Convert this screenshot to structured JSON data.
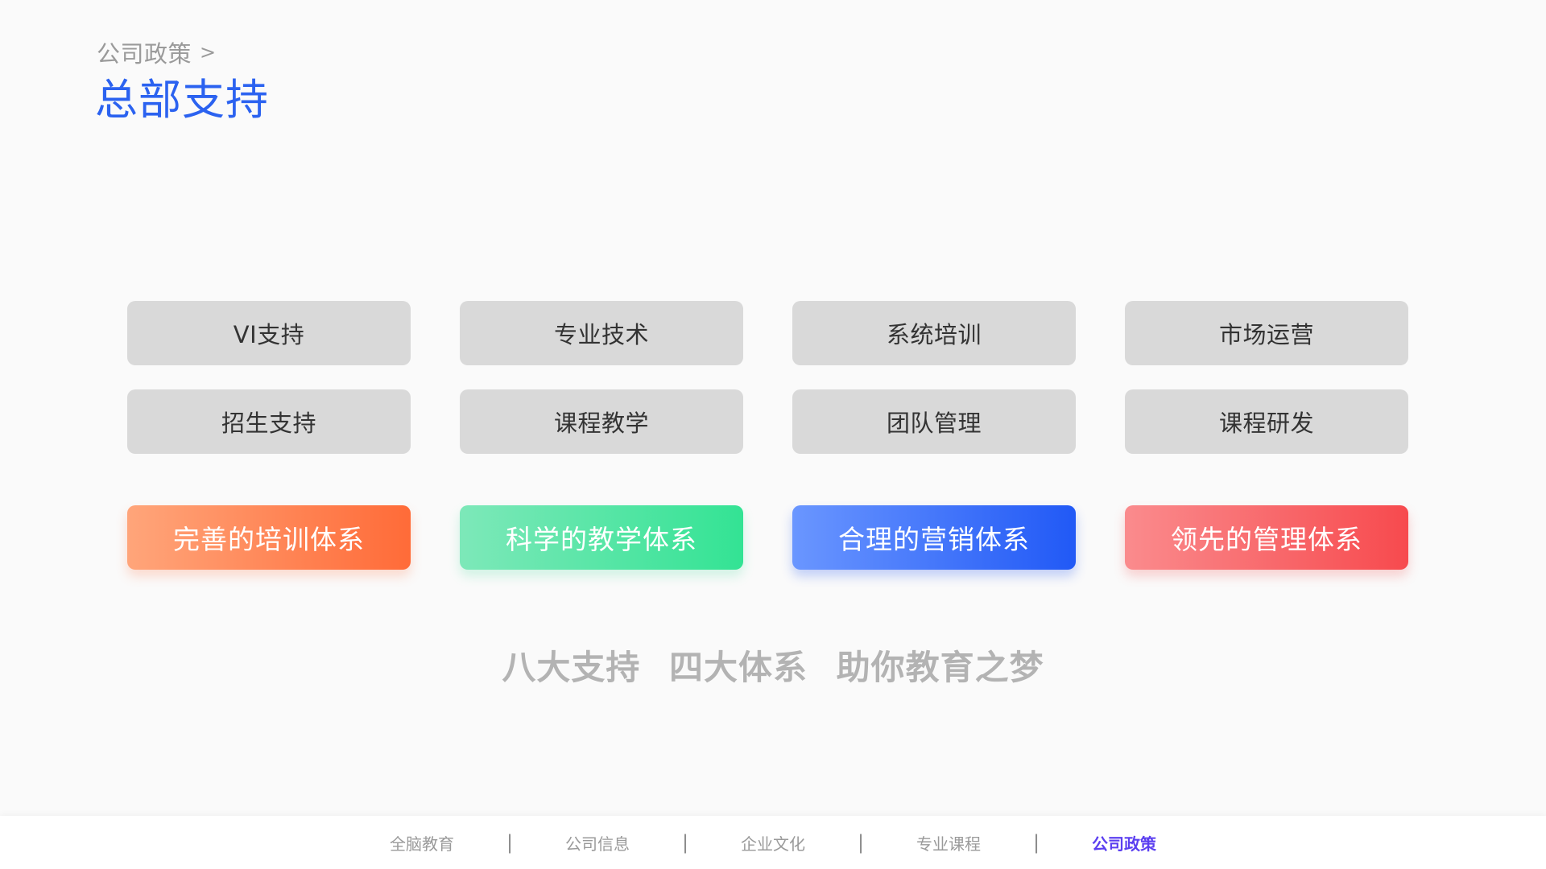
{
  "breadcrumb": {
    "parent": "公司政策",
    "separator": ">"
  },
  "page": {
    "title": "总部支持"
  },
  "supports": [
    {
      "label": "VI支持"
    },
    {
      "label": "专业技术"
    },
    {
      "label": "系统培训"
    },
    {
      "label": "市场运营"
    },
    {
      "label": "招生支持"
    },
    {
      "label": "课程教学"
    },
    {
      "label": "团队管理"
    },
    {
      "label": "课程研发"
    }
  ],
  "systems": [
    {
      "label": "完善的培训体系",
      "color_start": "#ffa57a",
      "color_end": "#ff6b38"
    },
    {
      "label": "科学的教学体系",
      "color_start": "#7de8b9",
      "color_end": "#33e394"
    },
    {
      "label": "合理的营销体系",
      "color_start": "#6a96ff",
      "color_end": "#2159f6"
    },
    {
      "label": "领先的管理体系",
      "color_start": "#fa8b8d",
      "color_end": "#f74a4e"
    }
  ],
  "slogan": "八大支持 四大体系 助你教育之梦",
  "footer": {
    "items": [
      {
        "label": "全脑教育"
      },
      {
        "label": "公司信息"
      },
      {
        "label": "企业文化"
      },
      {
        "label": "专业课程"
      },
      {
        "label": "公司政策",
        "active": true
      }
    ],
    "divider": "|"
  },
  "colors": {
    "title": "#2b62f0",
    "active_nav": "#5b3ff0",
    "card_gray": "#d9d9d9",
    "background": "#fafafa"
  }
}
